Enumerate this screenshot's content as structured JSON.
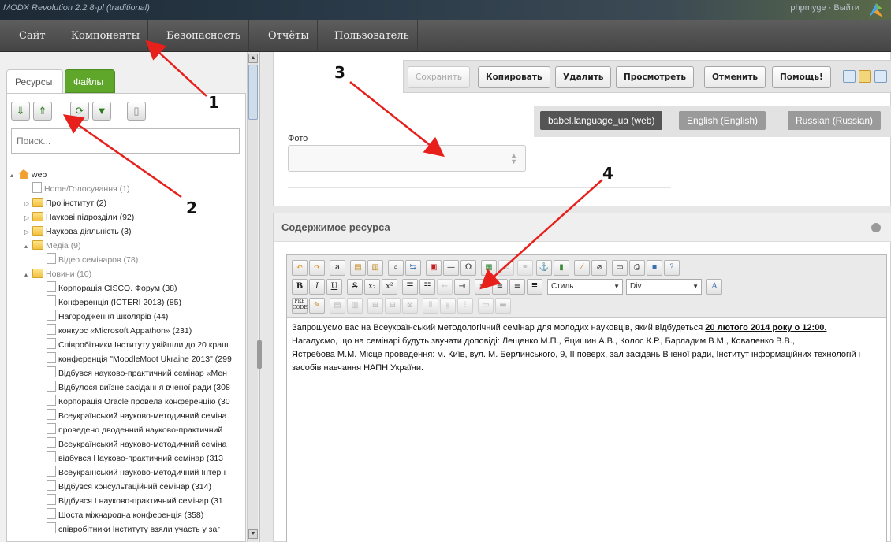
{
  "window": {
    "title": "MODX Revolution 2.2.8-pl (traditional)",
    "user_info": "phpmyge · Выйти"
  },
  "nav": {
    "items": [
      {
        "label": "Сайт"
      },
      {
        "label": "Компоненты"
      },
      {
        "label": "Безопасность"
      },
      {
        "label": "Отчёты"
      },
      {
        "label": "Пользователь"
      }
    ]
  },
  "left": {
    "tabs": [
      {
        "label": "Ресурсы"
      },
      {
        "label": "Файлы"
      }
    ],
    "toolbar_icons": [
      "arrow-down-icon",
      "arrow-up-icon",
      "refresh-icon",
      "sort-icon",
      "trash-icon"
    ],
    "search_placeholder": "Поиск...",
    "tree": [
      {
        "label": "web",
        "depth": 0,
        "type": "home",
        "toggle": "▴"
      },
      {
        "label": "Home/Голосування (1)",
        "depth": 1,
        "type": "page",
        "muted": true
      },
      {
        "label": "Про інститут (2)",
        "depth": 1,
        "type": "folder",
        "toggle": "▷"
      },
      {
        "label": "Наукові підрозділи (92)",
        "depth": 1,
        "type": "folder",
        "toggle": "▷"
      },
      {
        "label": "Наукова діяльність (3)",
        "depth": 1,
        "type": "folder",
        "toggle": "▷"
      },
      {
        "label": "Медіа (9)",
        "depth": 1,
        "type": "folder",
        "toggle": "▴",
        "muted": true
      },
      {
        "label": "Відео семінаров (78)",
        "depth": 2,
        "type": "page",
        "muted": true
      },
      {
        "label": "Новини (10)",
        "depth": 1,
        "type": "folder",
        "toggle": "▴",
        "muted": true
      },
      {
        "label": "Корпорація CISCO. Форум (38)",
        "depth": 2,
        "type": "page"
      },
      {
        "label": "Конференція (ICTERI 2013) (85)",
        "depth": 2,
        "type": "page"
      },
      {
        "label": "Нагородження школярів (44)",
        "depth": 2,
        "type": "page"
      },
      {
        "label": "конкурс «Microsoft Appathon» (231)",
        "depth": 2,
        "type": "page"
      },
      {
        "label": "Співробітники Інституту увійшли до 20 краш",
        "depth": 2,
        "type": "page"
      },
      {
        "label": "конференція \"MoodleMoot Ukraine 2013\" (299",
        "depth": 2,
        "type": "page"
      },
      {
        "label": "Відбувся науково-практичний семінар «Мен",
        "depth": 2,
        "type": "page"
      },
      {
        "label": "Відбулося виїзне засідання вченої ради (308",
        "depth": 2,
        "type": "page"
      },
      {
        "label": "Корпорація Oracle провела конференцію (30",
        "depth": 2,
        "type": "page"
      },
      {
        "label": "Всеукраїнський науково-методичний семіна",
        "depth": 2,
        "type": "page"
      },
      {
        "label": "проведено дводенний науково-практичний",
        "depth": 2,
        "type": "page"
      },
      {
        "label": "Всеукраїнський науково-методичний семіна",
        "depth": 2,
        "type": "page"
      },
      {
        "label": "відбувся Науково-практичний семінар (313",
        "depth": 2,
        "type": "page"
      },
      {
        "label": "Всеукраїнський науково-методичний Інтерн",
        "depth": 2,
        "type": "page"
      },
      {
        "label": "Відбувся консультаційний семінар (314)",
        "depth": 2,
        "type": "page"
      },
      {
        "label": "Відбувся І науково-практичний семінар (31",
        "depth": 2,
        "type": "page"
      },
      {
        "label": "Шоста міжнародна конференція (358)",
        "depth": 2,
        "type": "page"
      },
      {
        "label": "співробітники Інституту взяли участь у заг",
        "depth": 2,
        "type": "page"
      }
    ]
  },
  "actions": [
    {
      "label": "Сохранить",
      "disabled": true
    },
    {
      "label": "Копировать"
    },
    {
      "label": "Удалить"
    },
    {
      "label": "Просмотреть"
    },
    {
      "label": "Отменить"
    },
    {
      "label": "Помощь!"
    }
  ],
  "languages": [
    {
      "label": "babel.language_ua (web)",
      "active": true
    },
    {
      "label": "English (English)"
    },
    {
      "label": "Russian (Russian)"
    }
  ],
  "foto": {
    "label": "Фото"
  },
  "resource": {
    "title": "Содержимое ресурса",
    "toolbar": {
      "style_select": "Стиль",
      "format_select": "Div"
    },
    "body": {
      "p1_text": "Запрошуємо вас на Всеукраїнський методологічний семінар для молодих науковців, який відбудеться ",
      "p1_bold": "20 лютого 2014 року о 12:00.",
      "p2": "Нагадуємо, що на семінарі будуть звучати доповіді: Лещенко М.П., Яцишин А.В., Колос К.Р., Барладим В.М., Коваленко В.В.,",
      "p3": "Ястребова М.М. Місце проведення: м. Київ, вул. М. Берлинського, 9, ІІ поверх, зал засідань Вченої ради, Інститут інформаційних технологій і засобів навчання НАПН України."
    }
  },
  "annotations": [
    {
      "label": "1"
    },
    {
      "label": "2"
    },
    {
      "label": "3"
    },
    {
      "label": "4"
    }
  ],
  "colors": {
    "annotation_arrow": "#e8201c",
    "files_tab": "#5fa72a",
    "active_language": "#555555"
  }
}
